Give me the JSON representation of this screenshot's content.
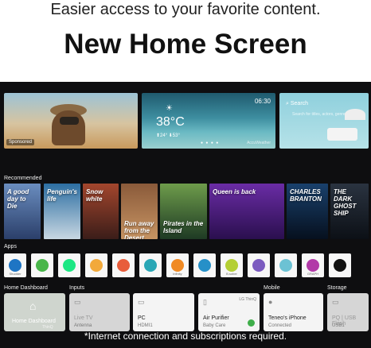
{
  "header": {
    "tagline": "Easier access to your favorite content.",
    "headline": "New Home Screen"
  },
  "hero": {
    "sponsored_label": "Sponsored",
    "weather": {
      "temperature": "38°C",
      "range": "⬆24° ⬇53°"
    },
    "clock": "06:30",
    "weather_brand": "AccuWeather",
    "search": {
      "label": "Search",
      "hint": "Search for titles, actors, genres."
    }
  },
  "sections": {
    "recommended": "Recommended",
    "apps": "Apps",
    "home_dashboard": "Home Dashboard",
    "inputs": "Inputs",
    "mobile": "Mobile",
    "storage": "Storage"
  },
  "recommended": [
    {
      "title": "A good day to Die",
      "color_top": "#6a8dbf",
      "color_bot": "#2b3f6a"
    },
    {
      "title": "Penguin's life",
      "color_top": "#2c6ea2",
      "color_bot": "#c8d7e2"
    },
    {
      "title": "Snow white",
      "color_top": "#a3462d",
      "color_bot": "#3b1d19"
    },
    {
      "title": "Run away from the Desert",
      "color_top": "#8a5a3a",
      "color_bot": "#c79463"
    },
    {
      "title": "Pirates in the Island",
      "color_top": "#6e9c4b",
      "color_bot": "#1e3a24"
    },
    {
      "title": "Queen is back",
      "color_top": "#6a2ca5",
      "color_bot": "#2a0f4e"
    },
    {
      "title": "CHARLES BRANTON",
      "color_top": "#19406c",
      "color_bot": "#06101e"
    },
    {
      "title": "THE DARK GHOST SHIP",
      "color_top": "#2a3340",
      "color_bot": "#0c1016"
    }
  ],
  "apps": [
    {
      "icon": "shudder-icon",
      "label": "Shudder",
      "color": "#1e75c4"
    },
    {
      "icon": "m-icon",
      "label": "",
      "color": "#49b64a"
    },
    {
      "icon": "hulu-icon",
      "label": "",
      "color": "#1ce783"
    },
    {
      "icon": "app-z-icon",
      "label": "",
      "color": "#f2a93b"
    },
    {
      "icon": "app-m-icon",
      "label": "",
      "color": "#e85d3b"
    },
    {
      "icon": "cocktail-icon",
      "label": "",
      "color": "#2aa7b6"
    },
    {
      "icon": "infinity-icon",
      "label": "infinity",
      "color": "#f08a24"
    },
    {
      "icon": "leaf-icon",
      "label": "",
      "color": "#2690c8"
    },
    {
      "icon": "b-icon",
      "label": "B.sober",
      "color": "#b4cf34"
    },
    {
      "icon": "molecule-icon",
      "label": "",
      "color": "#7b5bc0"
    },
    {
      "icon": "rings-icon",
      "label": "",
      "color": "#6cc2d4"
    },
    {
      "icon": "graph-icon",
      "label": "GRAPH",
      "color": "#b23aa8"
    },
    {
      "icon": "play-icon",
      "label": "",
      "color": "#111111"
    }
  ],
  "dashboard": [
    {
      "name": "Home Dashboard",
      "sub": "ThinQ",
      "icon": "home-icon",
      "bg": "#cfd5ce"
    },
    {
      "name": "Live TV",
      "sub": "Antenna",
      "icon": "tv-icon",
      "bg": "#d6d6d6"
    },
    {
      "name": "PC",
      "sub": "HDMI1",
      "icon": "monitor-icon",
      "bg": "#f4f4f4"
    },
    {
      "name": "Air Purifier",
      "sub": "Baby Care",
      "icon": "purifier-icon",
      "bg": "#f4f4f4",
      "tag": "LG ThinQ"
    },
    {
      "name": "Teneo's iPhone",
      "sub": "Connected",
      "icon": "avatar-icon",
      "bg": "#f4f4f4"
    },
    {
      "name": "PQ | USB Flash",
      "sub": "USB1",
      "icon": "usb-icon",
      "bg": "#d6d6d6"
    }
  ],
  "footnote": "*Internet connection and subscriptions required."
}
